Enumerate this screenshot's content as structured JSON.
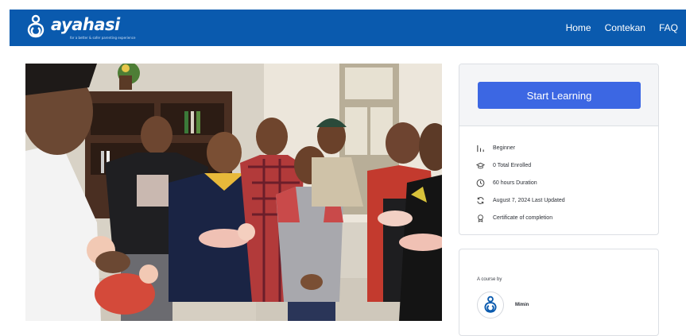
{
  "brand": {
    "name": "ayahasi",
    "tagline": "for a better & safer parenting experience",
    "color": "#0a5aae"
  },
  "nav": {
    "items": [
      {
        "label": "Home"
      },
      {
        "label": "Contekan"
      },
      {
        "label": "FAQ"
      }
    ]
  },
  "hero": {
    "image": "photo-men-holding-baby-dolls-training"
  },
  "course_card": {
    "start_label": "Start Learning",
    "button_color": "#3c67e3",
    "info": [
      {
        "icon": "level-bars-icon",
        "text": "Beginner"
      },
      {
        "icon": "graduation-cap-icon",
        "text": "0 Total Enrolled"
      },
      {
        "icon": "clock-icon",
        "text": "60 hours  Duration"
      },
      {
        "icon": "refresh-icon",
        "text": "August 7, 2024 Last Updated"
      },
      {
        "icon": "certificate-icon",
        "text": "Certificate of completion"
      }
    ]
  },
  "author": {
    "label": "A course by",
    "name": "Mimin"
  }
}
